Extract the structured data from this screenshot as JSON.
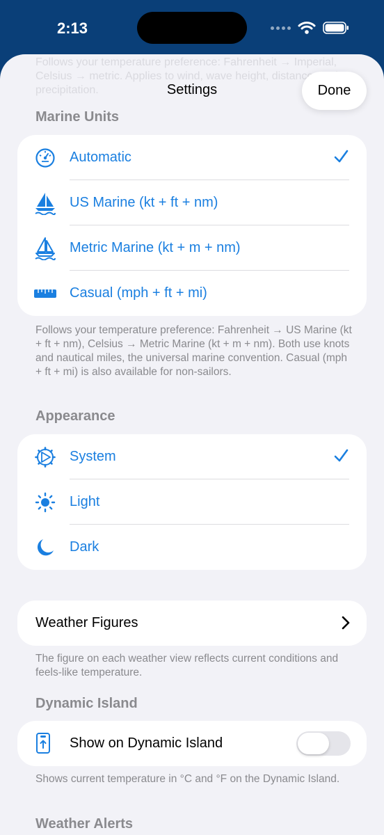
{
  "status_bar": {
    "time": "2:13"
  },
  "header": {
    "title": "Settings",
    "done_label": "Done",
    "faded_text": "Follows your temperature preference: Fahrenheit → Imperial, Celsius → metric. Applies to wind, wave height, distance, and precipitation."
  },
  "marine_units": {
    "header": "Marine Units",
    "options": [
      {
        "label": "Automatic",
        "icon": "gauge-icon",
        "selected": true
      },
      {
        "label": "US Marine (kt + ft + nm)",
        "icon": "sailboat-filled-icon",
        "selected": false
      },
      {
        "label": "Metric Marine (kt + m + nm)",
        "icon": "sailboat-icon",
        "selected": false
      },
      {
        "label": "Casual (mph + ft + mi)",
        "icon": "ruler-icon",
        "selected": false
      }
    ],
    "footer": "Follows your temperature preference: Fahrenheit → US Marine (kt + ft + nm), Celsius → Metric Marine (kt + m + nm). Both use knots and nautical miles, the universal marine convention. Casual (mph + ft + mi) is also available for non-sailors."
  },
  "appearance": {
    "header": "Appearance",
    "options": [
      {
        "label": "System",
        "icon": "gear-icon",
        "selected": true
      },
      {
        "label": "Light",
        "icon": "sun-icon",
        "selected": false
      },
      {
        "label": "Dark",
        "icon": "moon-icon",
        "selected": false
      }
    ]
  },
  "weather_figures": {
    "label": "Weather Figures",
    "footer": "The figure on each weather view reflects current conditions and feels-like temperature."
  },
  "dynamic_island": {
    "header": "Dynamic Island",
    "toggle_label": "Show on Dynamic Island",
    "enabled": false,
    "footer": "Shows current temperature in °C and °F on the Dynamic Island."
  },
  "weather_alerts": {
    "header": "Weather Alerts"
  },
  "colors": {
    "accent": "#1a7fe0",
    "background": "#f2f2f7",
    "header_bg": "#0a3f78"
  }
}
